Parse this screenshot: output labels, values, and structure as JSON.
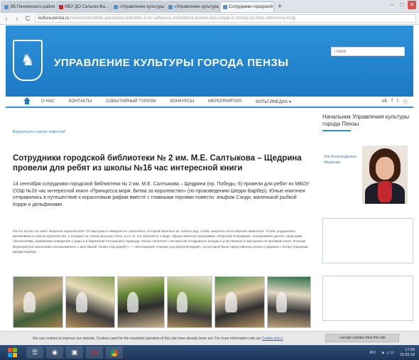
{
  "browser": {
    "tabs": [
      {
        "label": "ЭБ Пензенского района - Е"
      },
      {
        "label": "МБУ ДО Сельско-Ва..."
      },
      {
        "label": "«Управление культуры»"
      },
      {
        "label": "«Управление культуры»"
      },
      {
        "label": "Сотрудники городской б"
      }
    ],
    "new_tab": "+",
    "window_controls": {
      "minimize": "–",
      "maximize": "□",
      "close": "✕"
    },
    "nav": {
      "back": "‹",
      "forward": "›",
      "reload": "C"
    },
    "url_domain": "kultura-penza.ru",
    "url_rest": "/novosti/sotrudniki-gorodskoy-biblioteki-2-im-saltykova-shchedrina-proveli-dlya-rebyat-iz-shkoly-16-chas-interesnoy-knigi"
  },
  "site": {
    "logo_glyph": "♞",
    "title": "УПРАВЛЕНИЕ КУЛЬТУРЫ ГОРОДА ПЕНЗЫ",
    "search_placeholder": "Поиск"
  },
  "nav": {
    "items": [
      {
        "label": "О НАС"
      },
      {
        "label": "КОНТАКТЫ"
      },
      {
        "label": "СОБЫТИЙНЫЙ ТУРИЗМ"
      },
      {
        "label": "КОНКУРСЫ"
      },
      {
        "label": "МЕРОПРИЯТИЯ"
      },
      {
        "label": "МУЛЬТИМЕДИА ▾"
      }
    ],
    "social": [
      "ʋk",
      "f",
      "t",
      "ⓘ"
    ]
  },
  "article": {
    "breadcrumb": "Вернуться к списку новостей",
    "title": "Сотрудники городской библиотеки № 2 им. М.Е. Салтыкова – Щедрина провели для ребят из школы №16 час интересной книги",
    "lead": "14 сентября сотрудники городской библиотеки № 2 им. М.Е. Салтыкова – Щедрина (пр. Победы, 6) провели для ребят из МБОУ СОШ №16 час интересной книги «Принцесса моря. Битва за королевство» (по произведению Шерри Барбер). Юные книгочеи отправились в путешествие к коралловым рифам вместе с главными героями повести: эльфом Сэнди, маленькой рыбкой Корри и дельфинами.",
    "body": "Ни кто из вас не знает Морское королевство? От матушки и невероятно сказочного, который приплыл из теплых вод, чтобы защитить всех морских животных. Чтобы ухудшались виновников и спасти королевство, у которых не только высшие силы, но и те, кто заботится о море. Представители программы «Морской Посредник» познакомили детей с морскими обитателями, правилами поведения у воды и в бережном отношении к природе. Юные читатели с интересом отгадывали загадки и участвовали в викторине по мотивам книги. В конце мероприятия школьники познакомились с выставкой «Книги под водой»» — экспозицией «Сказки под морской водой», на которой были представлены книги и издания с иллюстрациями Шерри Барбер."
  },
  "sidebar": {
    "title": "Начальник Управления культуры города Пензы",
    "head_name": "Зоя Александровна Фёдорова"
  },
  "cookie": {
    "text": "We use cookies to improve our website. Cookies used for the essential operation of this site have already been set. For more information visit our",
    "link": "Cookie policy",
    "button": "I accept cookies from this site"
  },
  "taskbar": {
    "apps": [
      "☰",
      "◉",
      "▣",
      "O",
      ""
    ],
    "tray_lang": "RU",
    "tray_icons": "▲ ♫ ▭",
    "time": "17:00",
    "date": "15.09.18"
  }
}
